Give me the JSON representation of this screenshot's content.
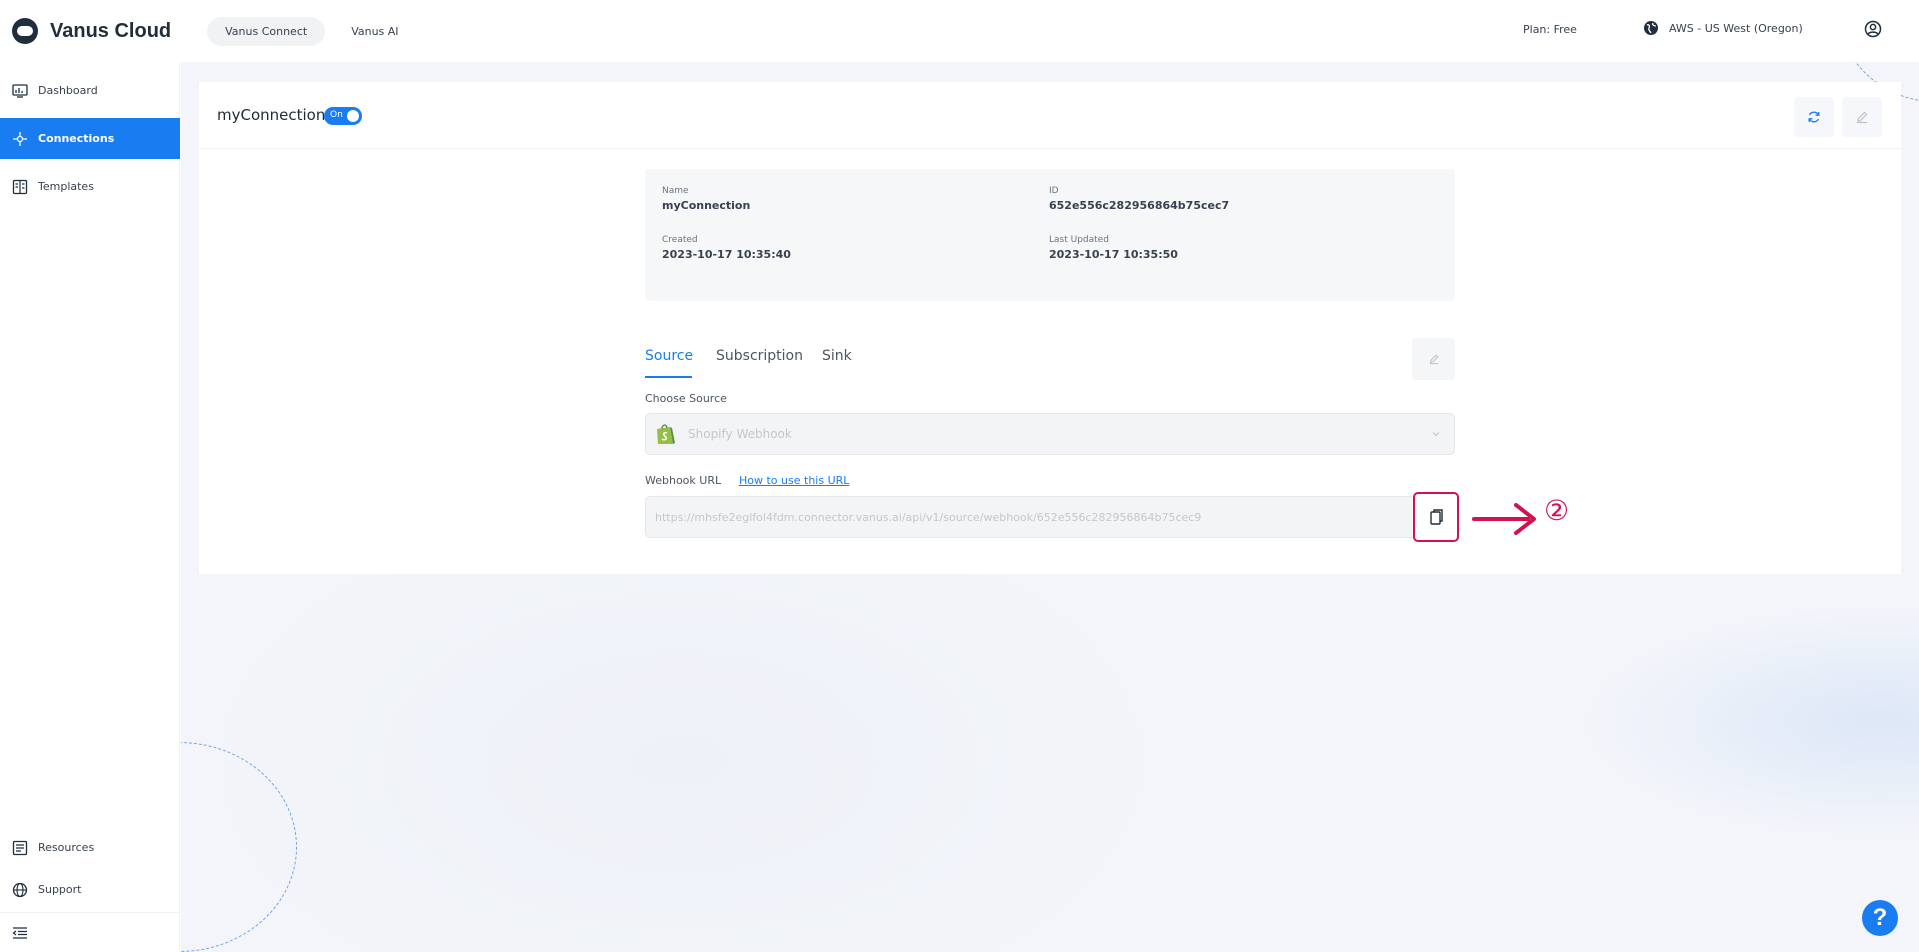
{
  "app": {
    "title": "Vanus Cloud"
  },
  "top_tabs": [
    {
      "label": "Vanus Connect",
      "active": true
    },
    {
      "label": "Vanus AI",
      "active": false
    }
  ],
  "plan_label": "Plan: Free",
  "region_label": "AWS - US West (Oregon)",
  "sidebar": {
    "items": [
      {
        "label": "Dashboard",
        "icon": "dashboard-icon"
      },
      {
        "label": "Connections",
        "icon": "connections-icon",
        "active": true
      },
      {
        "label": "Templates",
        "icon": "templates-icon"
      }
    ],
    "bottom_items": [
      {
        "label": "Resources",
        "icon": "resources-icon"
      },
      {
        "label": "Support",
        "icon": "globe-icon"
      }
    ]
  },
  "connection": {
    "title": "myConnection",
    "toggle_label": "On",
    "toggle_on": true
  },
  "info": {
    "name_label": "Name",
    "name_value": "myConnection",
    "id_label": "ID",
    "id_value": "652e556c282956864b75cec7",
    "created_label": "Created",
    "created_value": "2023-10-17 10:35:40",
    "updated_label": "Last Updated",
    "updated_value": "2023-10-17 10:35:50"
  },
  "tabs": [
    {
      "label": "Source",
      "active": true
    },
    {
      "label": "Subscription",
      "active": false
    },
    {
      "label": "Sink",
      "active": false
    }
  ],
  "source": {
    "choose_label": "Choose Source",
    "selected": "Shopify Webhook",
    "webhook_label": "Webhook URL",
    "how_link": "How to use this URL",
    "webhook_url": "https://mhsfe2eglfol4fdm.connector.vanus.ai/api/v1/source/webhook/652e556c282956864b75cec9"
  },
  "annotation": {
    "number": "②"
  },
  "help_label": "?",
  "colors": {
    "accent": "#1a7cf1",
    "annotation": "#d0134f"
  }
}
